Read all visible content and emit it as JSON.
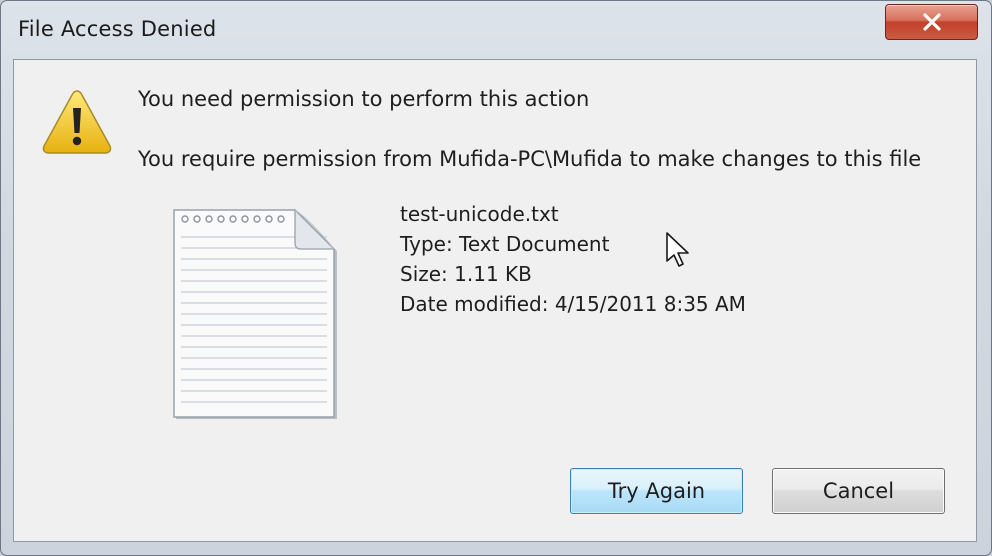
{
  "window": {
    "title": "File Access Denied",
    "close_icon": "close-icon"
  },
  "message": {
    "icon": "warning-icon",
    "heading": "You need permission to perform this action",
    "detail": "You require permission from Mufida-PC\\Mufida to make changes to this file"
  },
  "file": {
    "icon": "text-document-icon",
    "name": "test-unicode.txt",
    "type": "Type: Text Document",
    "size": "Size: 1.11 KB",
    "date_modified": "Date modified: 4/15/2011 8:35 AM"
  },
  "buttons": {
    "try_again": "Try Again",
    "cancel": "Cancel"
  },
  "colors": {
    "close_button": "#c7432d",
    "default_button_border": "#3c7fb1",
    "warning_yellow": "#f3c51c"
  }
}
